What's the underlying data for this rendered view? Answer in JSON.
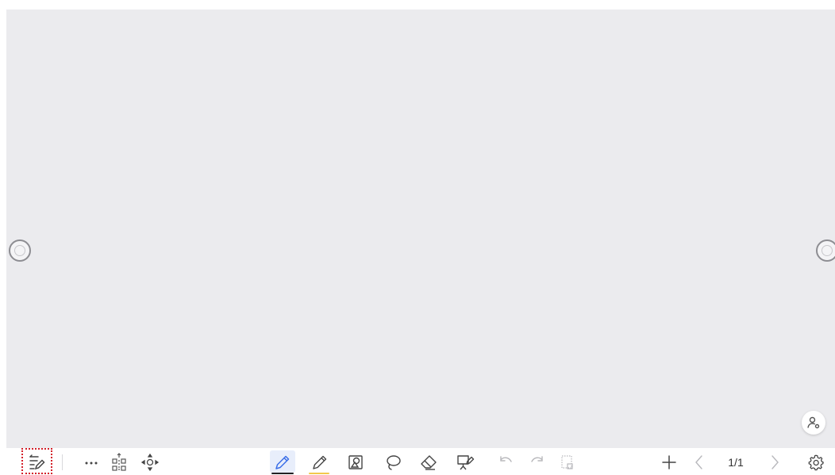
{
  "toolbar": {
    "page_indicator": "1/1",
    "accent_color": "#3a6ee8",
    "pen_underline_color": "#222222",
    "highlighter_underline_color": "#f2c94c",
    "items": [
      {
        "id": "toggle-toolbar",
        "icon": "list-edit-icon"
      },
      {
        "id": "more",
        "icon": "more-dots-icon"
      },
      {
        "id": "scan-code",
        "icon": "qr-scan-icon"
      },
      {
        "id": "move-toolbar",
        "icon": "move-arrows-icon"
      },
      {
        "id": "pen",
        "icon": "pen-icon",
        "active": true
      },
      {
        "id": "highlighter",
        "icon": "highlighter-icon"
      },
      {
        "id": "shape",
        "icon": "shape-icon"
      },
      {
        "id": "lasso",
        "icon": "lasso-icon"
      },
      {
        "id": "eraser",
        "icon": "eraser-icon"
      },
      {
        "id": "whiteboard-background",
        "icon": "easel-icon"
      },
      {
        "id": "undo",
        "icon": "undo-icon",
        "enabled": false
      },
      {
        "id": "redo",
        "icon": "redo-icon",
        "enabled": false
      },
      {
        "id": "clear",
        "icon": "clear-page-icon",
        "enabled": false
      },
      {
        "id": "add-page",
        "icon": "plus-icon"
      },
      {
        "id": "prev-page",
        "icon": "chevron-left-icon",
        "enabled": false
      },
      {
        "id": "next-page",
        "icon": "chevron-right-icon",
        "enabled": false
      },
      {
        "id": "settings",
        "icon": "gear-icon"
      }
    ]
  },
  "canvas": {
    "background_color": "#ebebee",
    "user_button_icon": "user-icon"
  }
}
